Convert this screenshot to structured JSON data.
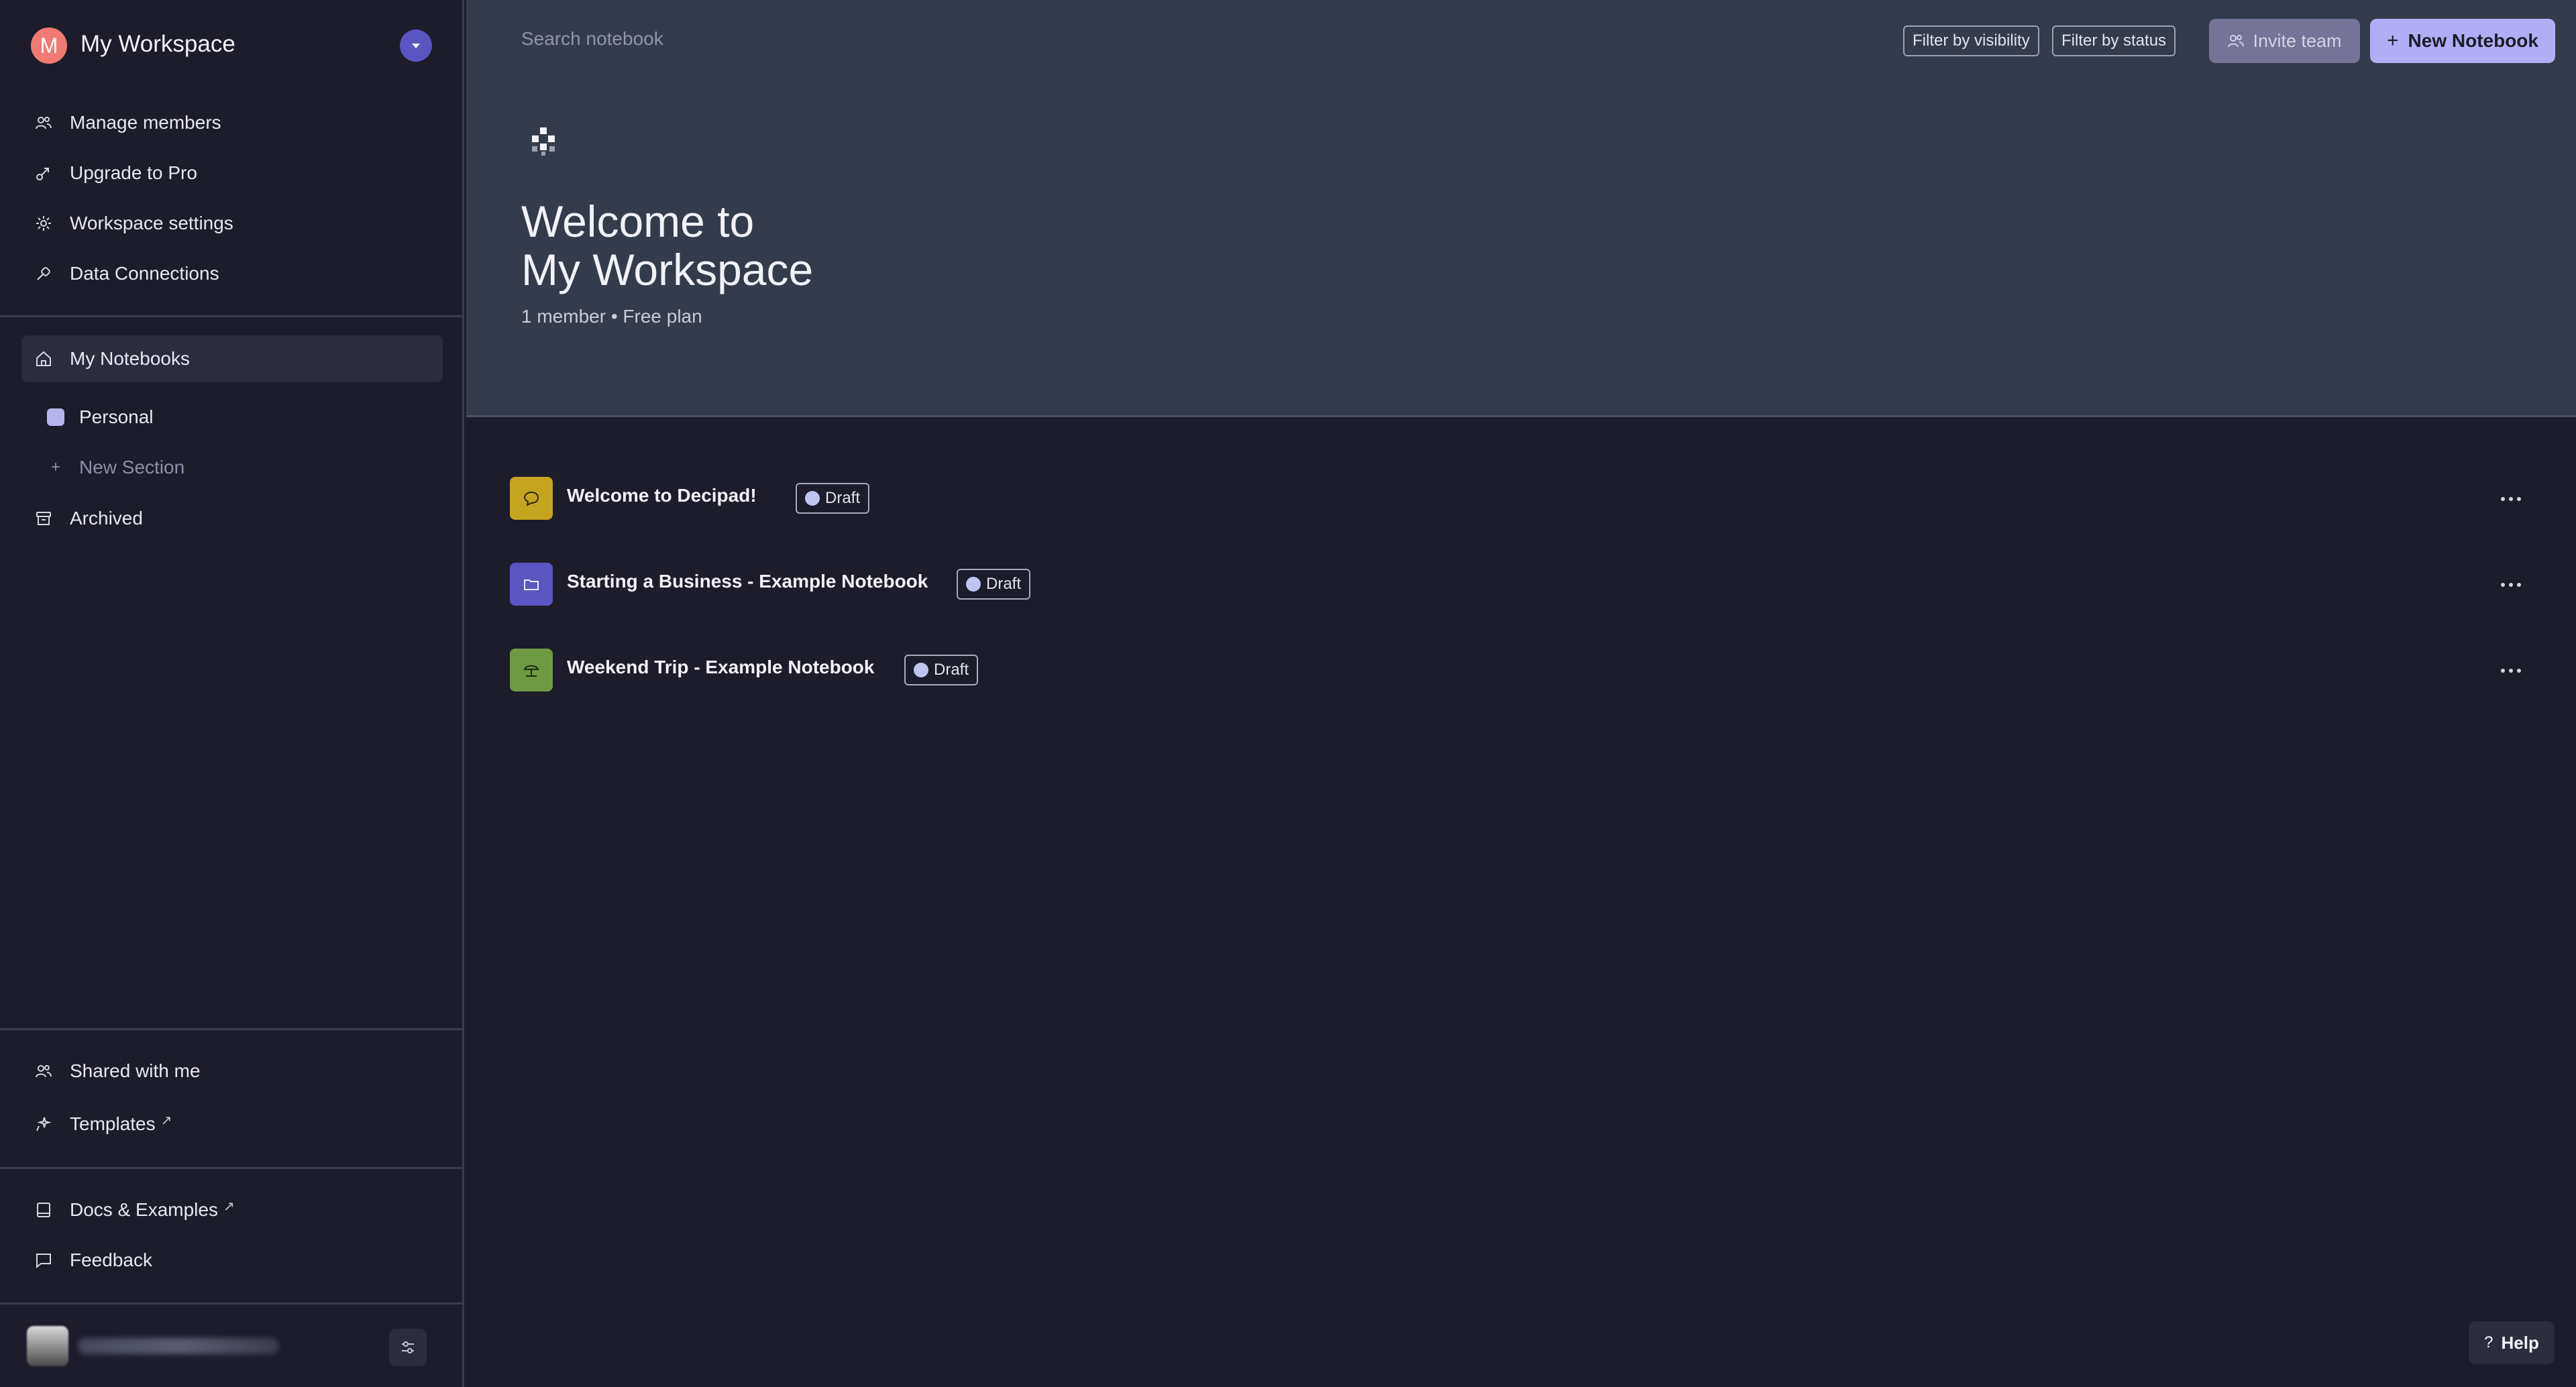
{
  "workspace": {
    "initial": "M",
    "name": "My Workspace"
  },
  "sidebar": {
    "top_items": [
      {
        "label": "Manage members",
        "icon": "users-icon"
      },
      {
        "label": "Upgrade to Pro",
        "icon": "upgrade-icon"
      },
      {
        "label": "Workspace settings",
        "icon": "gear-icon"
      },
      {
        "label": "Data Connections",
        "icon": "link-icon"
      }
    ],
    "my_notebooks": "My Notebooks",
    "sections": [
      {
        "label": "Personal",
        "color": "#b7b5ee"
      }
    ],
    "new_section": "New Section",
    "archived": "Archived",
    "shared_with_me": "Shared with me",
    "templates": "Templates",
    "docs": "Docs & Examples",
    "feedback": "Feedback",
    "external_mark": "↗"
  },
  "header": {
    "search_placeholder": "Search notebook",
    "filter_visibility": "Filter by visibility",
    "filter_status": "Filter by status",
    "invite_team": "Invite team",
    "new_notebook": "New Notebook",
    "new_notebook_plus": "+"
  },
  "hero": {
    "title_line1": "Welcome to",
    "title_line2": "My Workspace",
    "subtitle": "1 member • Free plan"
  },
  "notebooks": [
    {
      "title": "Welcome to Decipad!",
      "status": "Draft",
      "icon": "chat-bubble-icon",
      "color": "#c5a420"
    },
    {
      "title": "Starting a Business - Example Notebook",
      "status": "Draft",
      "icon": "folder-icon",
      "color": "#5b55c2"
    },
    {
      "title": "Weekend Trip - Example Notebook",
      "status": "Draft",
      "icon": "beach-umbrella-icon",
      "color": "#6f9a43"
    }
  ],
  "help": {
    "glyph": "?",
    "label": "Help"
  },
  "colors": {
    "accent": "#b1aef5",
    "workspace_avatar": "#f07a74",
    "sidebar_bg": "#1c1c2b",
    "header_bg": "#343c4c"
  }
}
